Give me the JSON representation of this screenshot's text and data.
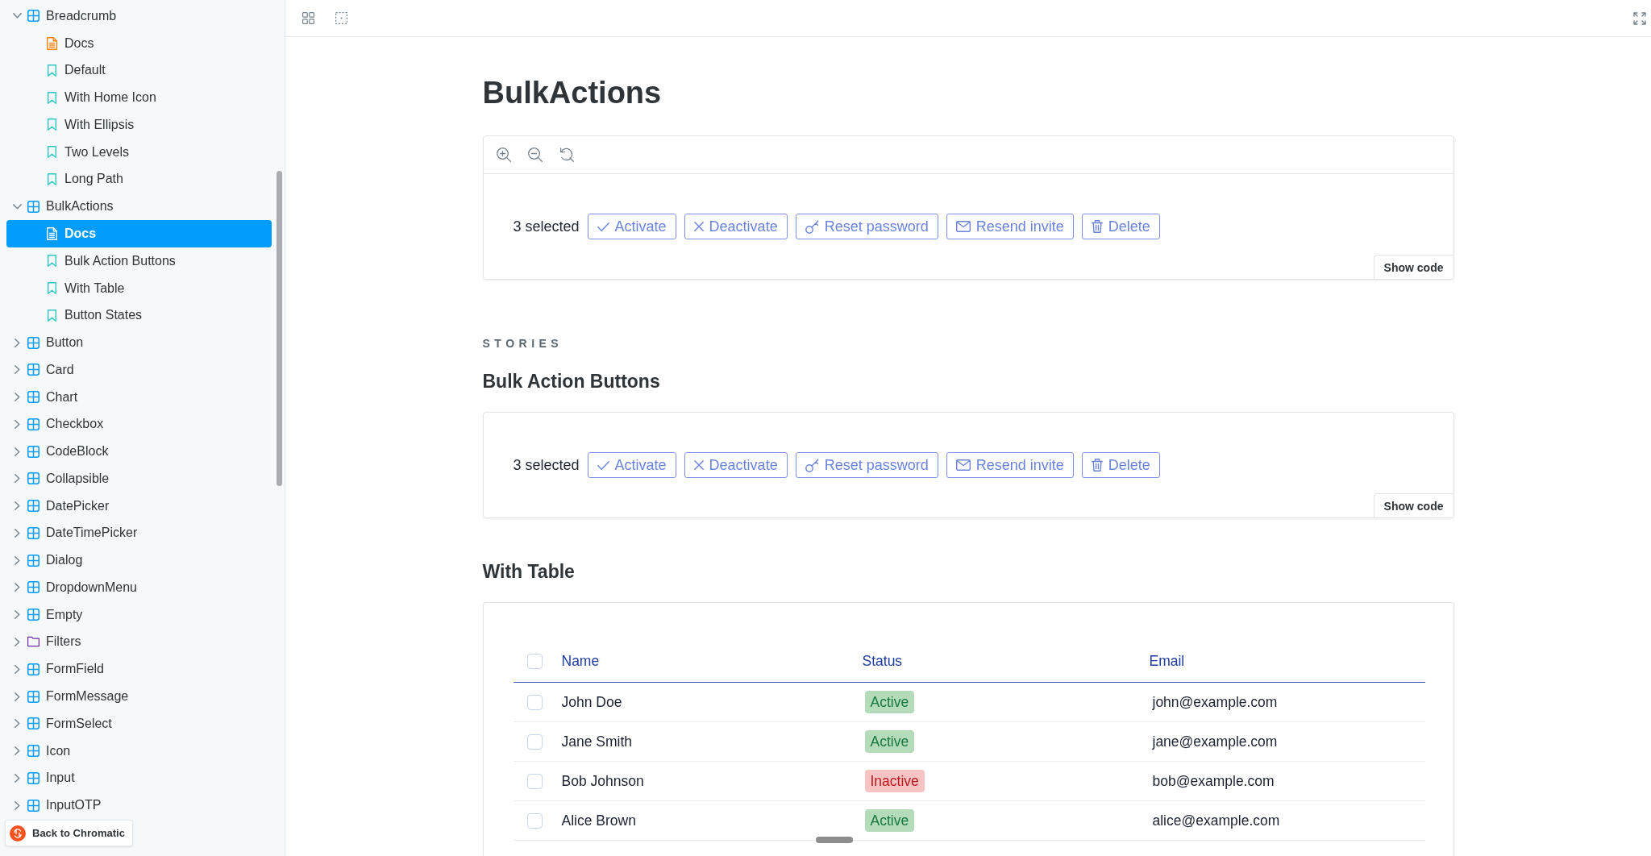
{
  "sidebar": {
    "items": [
      {
        "label": "Breadcrumb",
        "kind": "component",
        "expanded": true,
        "selected": false,
        "children": [
          {
            "label": "Docs",
            "kind": "docs",
            "selected": false
          },
          {
            "label": "Default",
            "kind": "story",
            "selected": false
          },
          {
            "label": "With Home Icon",
            "kind": "story",
            "selected": false
          },
          {
            "label": "With Ellipsis",
            "kind": "story",
            "selected": false
          },
          {
            "label": "Two Levels",
            "kind": "story",
            "selected": false
          },
          {
            "label": "Long Path",
            "kind": "story",
            "selected": false
          }
        ]
      },
      {
        "label": "BulkActions",
        "kind": "component",
        "expanded": true,
        "selected": false,
        "children": [
          {
            "label": "Docs",
            "kind": "docs",
            "selected": true
          },
          {
            "label": "Bulk Action Buttons",
            "kind": "story",
            "selected": false
          },
          {
            "label": "With Table",
            "kind": "story",
            "selected": false
          },
          {
            "label": "Button States",
            "kind": "story",
            "selected": false
          }
        ]
      },
      {
        "label": "Button",
        "kind": "component",
        "expanded": false,
        "selected": false
      },
      {
        "label": "Card",
        "kind": "component",
        "expanded": false,
        "selected": false
      },
      {
        "label": "Chart",
        "kind": "component",
        "expanded": false,
        "selected": false
      },
      {
        "label": "Checkbox",
        "kind": "component",
        "expanded": false,
        "selected": false
      },
      {
        "label": "CodeBlock",
        "kind": "component",
        "expanded": false,
        "selected": false
      },
      {
        "label": "Collapsible",
        "kind": "component",
        "expanded": false,
        "selected": false
      },
      {
        "label": "DatePicker",
        "kind": "component",
        "expanded": false,
        "selected": false
      },
      {
        "label": "DateTimePicker",
        "kind": "component",
        "expanded": false,
        "selected": false
      },
      {
        "label": "Dialog",
        "kind": "component",
        "expanded": false,
        "selected": false
      },
      {
        "label": "DropdownMenu",
        "kind": "component",
        "expanded": false,
        "selected": false
      },
      {
        "label": "Empty",
        "kind": "component",
        "expanded": false,
        "selected": false
      },
      {
        "label": "Filters",
        "kind": "folder",
        "expanded": false,
        "selected": false
      },
      {
        "label": "FormField",
        "kind": "component",
        "expanded": false,
        "selected": false
      },
      {
        "label": "FormMessage",
        "kind": "component",
        "expanded": false,
        "selected": false
      },
      {
        "label": "FormSelect",
        "kind": "component",
        "expanded": false,
        "selected": false
      },
      {
        "label": "Icon",
        "kind": "component",
        "expanded": false,
        "selected": false
      },
      {
        "label": "Input",
        "kind": "component",
        "expanded": false,
        "selected": false
      },
      {
        "label": "InputOTP",
        "kind": "component",
        "expanded": false,
        "selected": false
      }
    ],
    "back_button": "Back to Chromatic"
  },
  "docs": {
    "title": "BulkActions",
    "preview": {
      "selection_label": "3 selected",
      "actions": [
        {
          "label": "Activate",
          "kind": "activate"
        },
        {
          "label": "Deactivate",
          "kind": "deactivate"
        },
        {
          "label": "Reset password",
          "kind": "reset"
        },
        {
          "label": "Resend invite",
          "kind": "invite"
        },
        {
          "label": "Delete",
          "kind": "delete"
        }
      ],
      "show_code": "Show code"
    },
    "stories_heading": "STORIES",
    "stories": [
      {
        "title": "Bulk Action Buttons",
        "kind": "actions",
        "selection_label": "3 selected",
        "actions": [
          {
            "label": "Activate",
            "kind": "activate"
          },
          {
            "label": "Deactivate",
            "kind": "deactivate"
          },
          {
            "label": "Reset password",
            "kind": "reset"
          },
          {
            "label": "Resend invite",
            "kind": "invite"
          },
          {
            "label": "Delete",
            "kind": "delete"
          }
        ],
        "show_code": "Show code"
      },
      {
        "title": "With Table",
        "kind": "table",
        "table": {
          "header_checked": false,
          "columns": [
            "Name",
            "Status",
            "Email"
          ],
          "rows": [
            {
              "checked": false,
              "name": "John Doe",
              "status": {
                "label": "Active",
                "kind": "positive"
              },
              "email": "john@example.com"
            },
            {
              "checked": false,
              "name": "Jane Smith",
              "status": {
                "label": "Active",
                "kind": "positive"
              },
              "email": "jane@example.com"
            },
            {
              "checked": false,
              "name": "Bob Johnson",
              "status": {
                "label": "Inactive",
                "kind": "negative"
              },
              "email": "bob@example.com"
            },
            {
              "checked": false,
              "name": "Alice Brown",
              "status": {
                "label": "Active",
                "kind": "positive"
              },
              "email": "alice@example.com"
            }
          ]
        }
      }
    ]
  }
}
